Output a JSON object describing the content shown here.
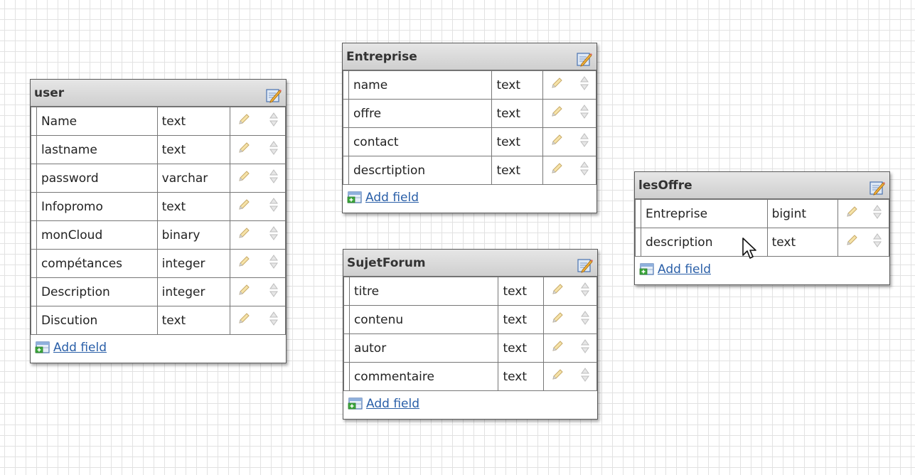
{
  "colors": {
    "header_bg": "#d6d6d6",
    "link": "#2a5fa8",
    "grid": "#e2e2e2",
    "border": "#5a5a5a"
  },
  "icons": {
    "edit_table": "edit-table-icon",
    "edit_field": "pencil-icon",
    "reorder": "up-down-arrows-icon",
    "add_field": "add-field-icon",
    "cursor": "mouse-pointer-icon"
  },
  "tables": {
    "user": {
      "name": "user",
      "add_label": "Add field",
      "fields": [
        {
          "name": "Name",
          "type": "text"
        },
        {
          "name": "lastname",
          "type": "text"
        },
        {
          "name": "password",
          "type": "varchar"
        },
        {
          "name": "Infopromo",
          "type": "text"
        },
        {
          "name": "monCloud",
          "type": "binary"
        },
        {
          "name": "compétances",
          "type": "integer"
        },
        {
          "name": "Description",
          "type": "integer"
        },
        {
          "name": "Discution",
          "type": "text"
        }
      ]
    },
    "entreprise": {
      "name": "Entreprise",
      "add_label": "Add field",
      "fields": [
        {
          "name": "name",
          "type": "text"
        },
        {
          "name": "offre",
          "type": "text"
        },
        {
          "name": "contact",
          "type": "text"
        },
        {
          "name": "descrtiption",
          "type": "text"
        }
      ]
    },
    "sujetforum": {
      "name": "SujetForum",
      "add_label": "Add field",
      "fields": [
        {
          "name": "titre",
          "type": "text"
        },
        {
          "name": "contenu",
          "type": "text"
        },
        {
          "name": "autor",
          "type": "text"
        },
        {
          "name": "commentaire",
          "type": "text"
        }
      ]
    },
    "lesoffre": {
      "name": "lesOffre",
      "add_label": "Add field",
      "fields": [
        {
          "name": "Entreprise",
          "type": "bigint"
        },
        {
          "name": "description",
          "type": "text"
        }
      ]
    }
  }
}
